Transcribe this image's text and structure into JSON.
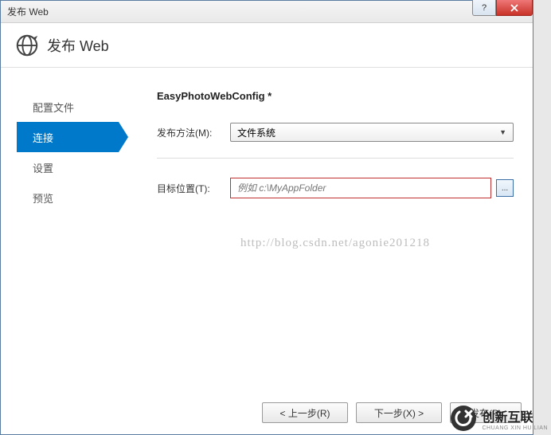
{
  "window": {
    "title": "发布 Web"
  },
  "header": {
    "title": "发布 Web"
  },
  "sidebar": {
    "items": [
      {
        "label": "配置文件"
      },
      {
        "label": "连接"
      },
      {
        "label": "设置"
      },
      {
        "label": "预览"
      }
    ]
  },
  "main": {
    "config_name": "EasyPhotoWebConfig *",
    "publish_method_label": "发布方法(M):",
    "publish_method_value": "文件系统",
    "target_label": "目标位置(T):",
    "target_placeholder": "例如 c:\\MyAppFolder",
    "browse_label": "..."
  },
  "watermark": "http://blog.csdn.net/agonie201218",
  "footer": {
    "prev": "< 上一步(R)",
    "next": "下一步(X) >",
    "publish": "发布(P)"
  },
  "brand": {
    "name": "创新互联",
    "sub": "CHUANG XIN HU LIAN"
  }
}
